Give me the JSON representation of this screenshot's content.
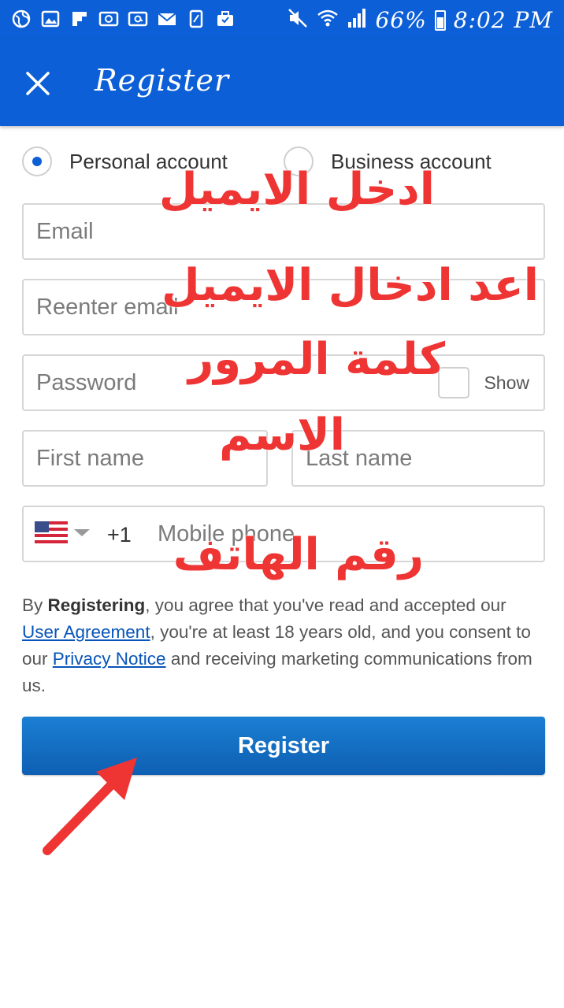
{
  "status_bar": {
    "battery": "66%",
    "time": "8:02 PM",
    "left_icons": [
      "globe-icon",
      "image-icon",
      "flipboard-icon",
      "mail-icon",
      "at-mail-icon",
      "envelope-icon",
      "document-icon",
      "briefcase-icon"
    ]
  },
  "toolbar": {
    "title": "Register"
  },
  "account_type": {
    "personal_label": "Personal account",
    "business_label": "Business account",
    "selected": "personal"
  },
  "form": {
    "email_placeholder": "Email",
    "reenter_email_placeholder": "Reenter email",
    "password_placeholder": "Password",
    "show_label": "Show",
    "first_name_placeholder": "First name",
    "last_name_placeholder": "Last name",
    "dial_code": "+1",
    "phone_placeholder": "Mobile phone"
  },
  "terms": {
    "prefix": "By ",
    "bold": "Registering",
    "part1": ", you agree that you've read and accepted our ",
    "user_agreement": "User Agreement",
    "part2": ", you're at least 18 years old, and you consent to our ",
    "privacy_notice": "Privacy Notice",
    "part3": " and receiving marketing communications from us."
  },
  "register_button": "Register",
  "annotations": {
    "email": "ادخل الايميل",
    "reenter_email": "اعد ادخال الايميل",
    "password": "كلمة المرور",
    "name": "الاسم",
    "phone": "رقم الهاتف"
  },
  "colors": {
    "brand_blue": "#0c5fd6",
    "button_blue": "#1670c4",
    "annotation_red": "#ef3434",
    "link_blue": "#0654ba"
  }
}
